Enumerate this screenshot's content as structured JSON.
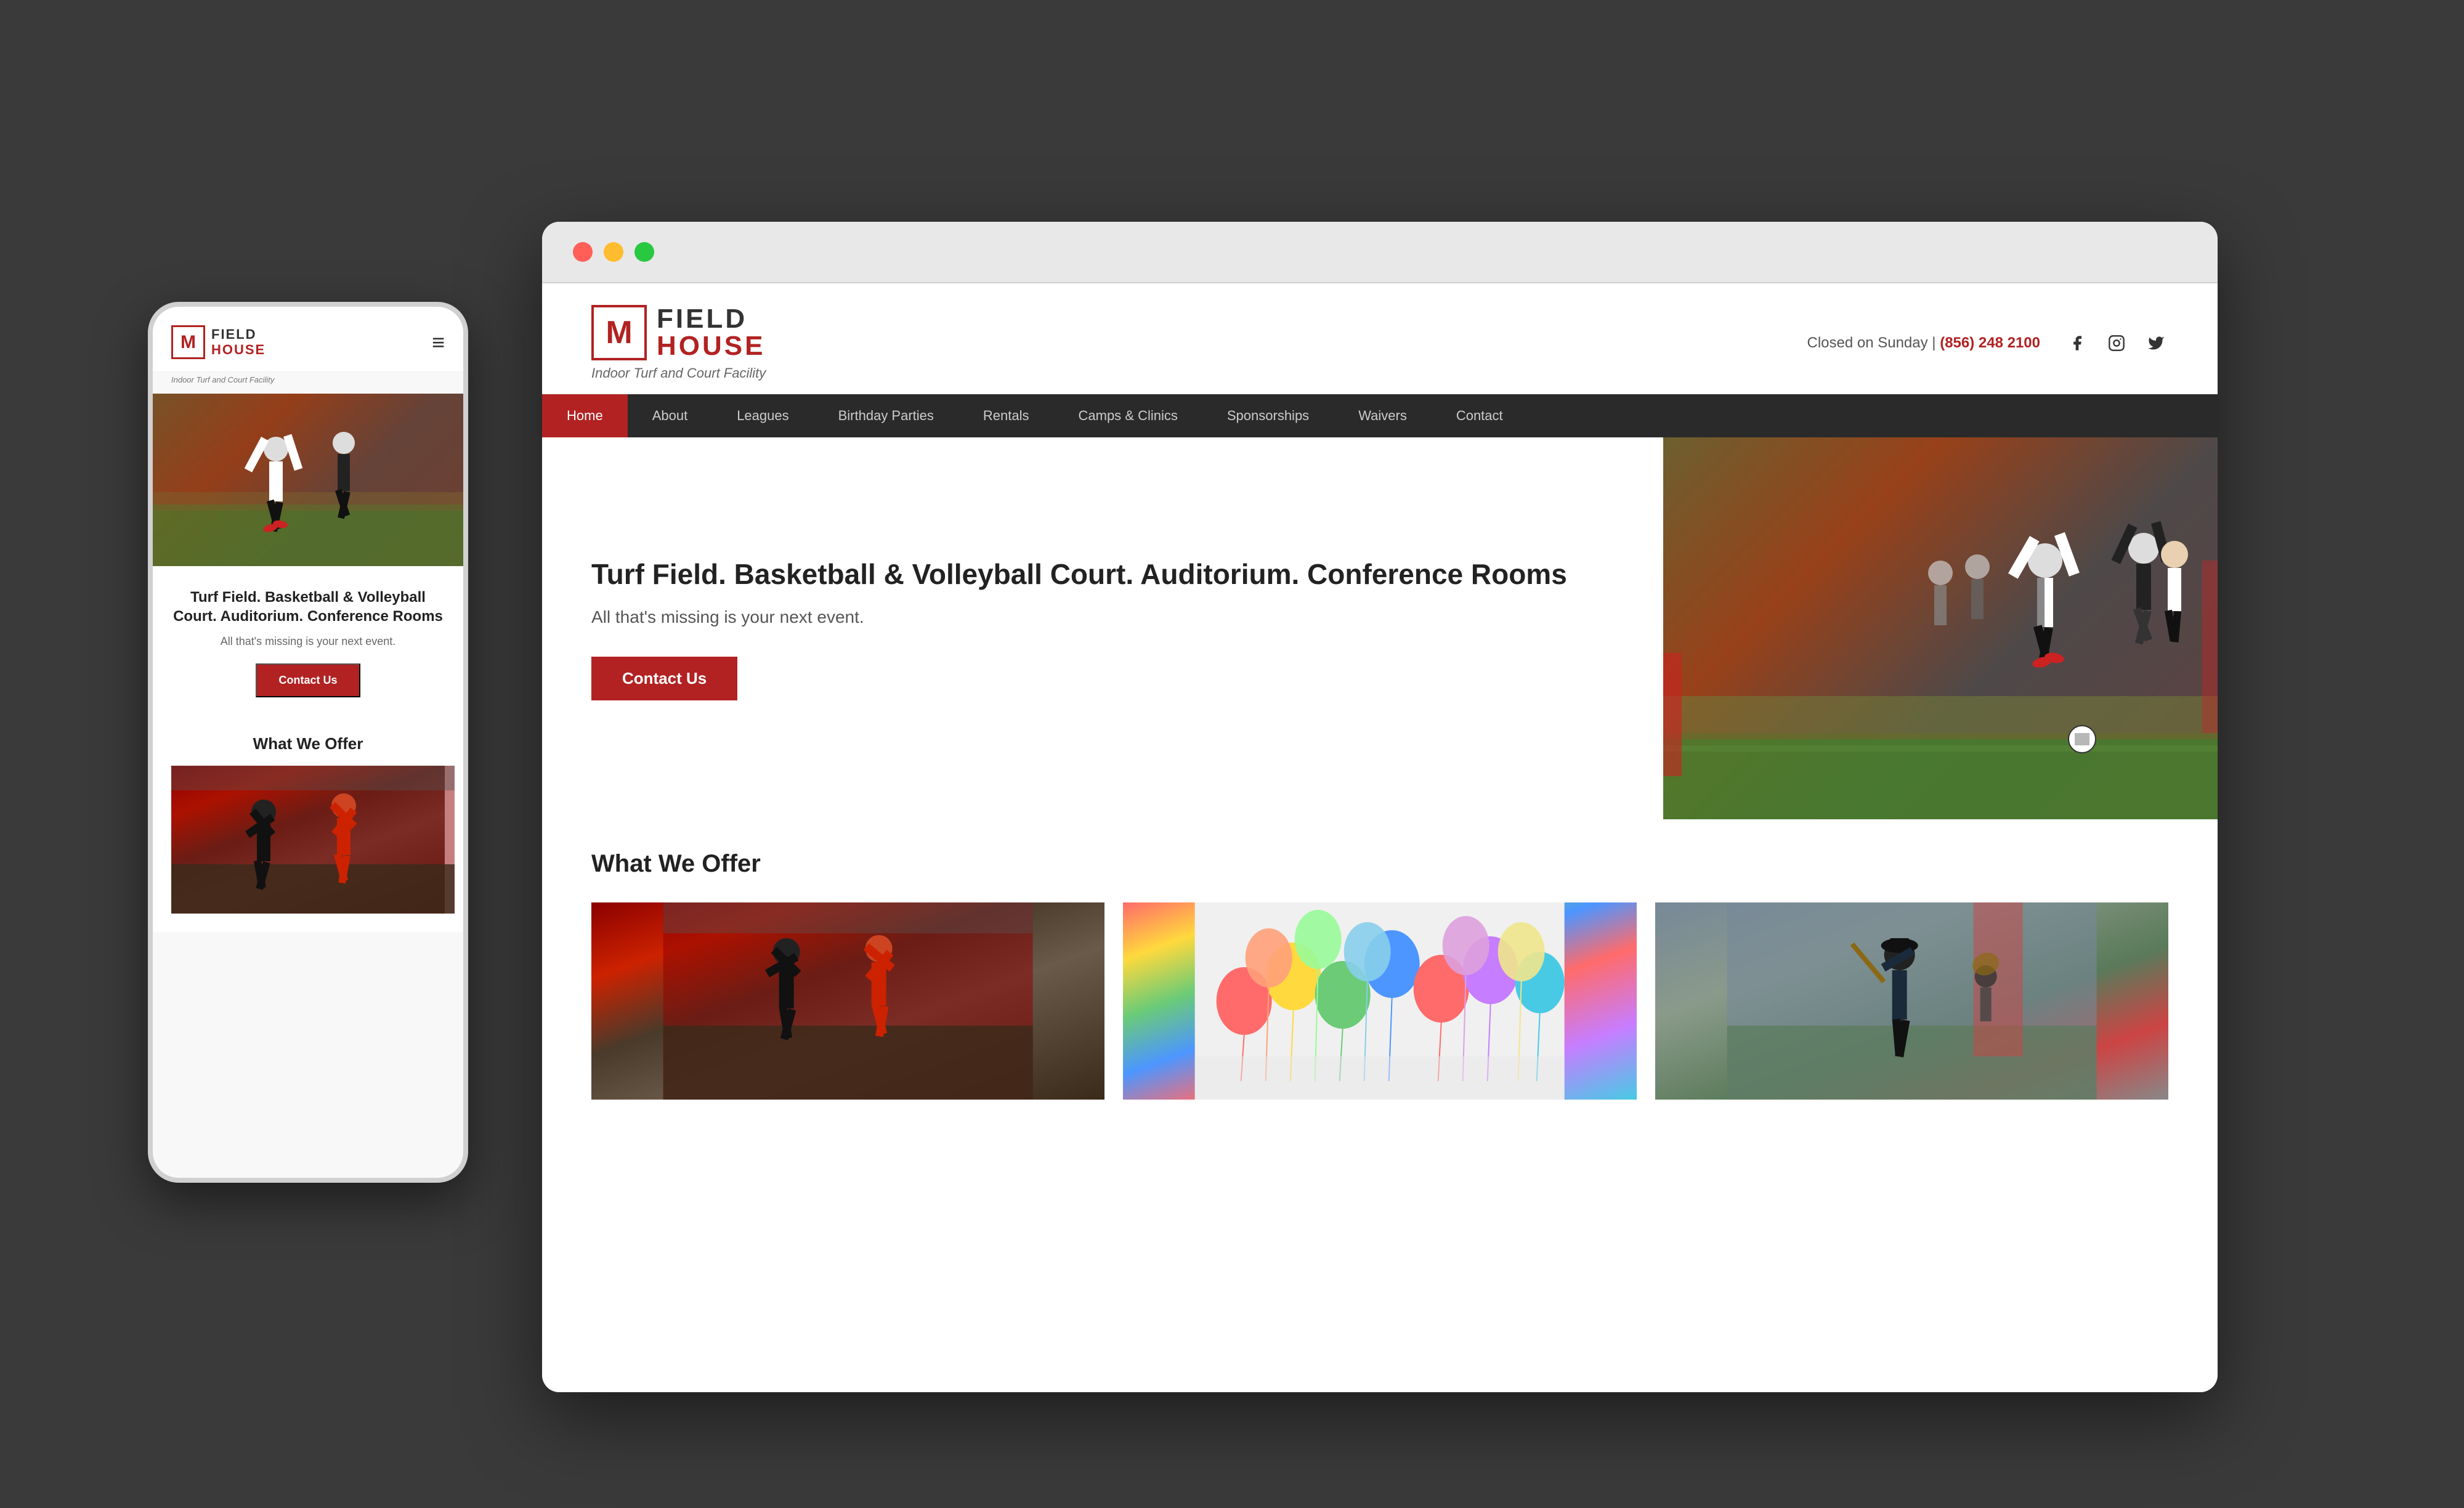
{
  "page": {
    "background": "#3a3a3a"
  },
  "browser": {
    "buttons": {
      "red": "close",
      "yellow": "minimize",
      "green": "maximize"
    }
  },
  "desktop": {
    "header": {
      "logo": {
        "field_text": "FIELD",
        "house_text": "HOUSE",
        "subtitle": "Indoor Turf and Court Facility",
        "m_letter": "M"
      },
      "contact_info": "Closed on Sunday",
      "pipe": "|",
      "phone": "(856) 248 2100",
      "social": {
        "facebook": "f",
        "instagram": "ig",
        "twitter": "tw"
      }
    },
    "nav": {
      "items": [
        {
          "label": "Home",
          "active": true
        },
        {
          "label": "About",
          "active": false
        },
        {
          "label": "Leagues",
          "active": false
        },
        {
          "label": "Birthday Parties",
          "active": false
        },
        {
          "label": "Rentals",
          "active": false
        },
        {
          "label": "Camps & Clinics",
          "active": false
        },
        {
          "label": "Sponsorships",
          "active": false
        },
        {
          "label": "Waivers",
          "active": false
        },
        {
          "label": "Contact",
          "active": false
        }
      ]
    },
    "hero": {
      "title": "Turf Field. Basketball & Volleyball Court. Auditorium. Conference Rooms",
      "subtitle": "All that's missing is your next event.",
      "button_label": "Contact Us"
    },
    "offers": {
      "section_title": "What We Offer",
      "cards": [
        {
          "id": "basketball",
          "alt": "Basketball court"
        },
        {
          "id": "balloons",
          "alt": "Birthday party balloons"
        },
        {
          "id": "baseball",
          "alt": "Baseball player"
        }
      ]
    }
  },
  "mobile": {
    "header": {
      "logo": {
        "field_text": "FIELD",
        "house_text": "HOUSE",
        "subtitle": "Indoor Turf and Court Facility",
        "m_letter": "M"
      },
      "menu_icon": "≡"
    },
    "hero": {
      "title": "Turf Field. Basketball & Volleyball Court. Auditorium. Conference Rooms",
      "subtitle": "All that's missing is your next event.",
      "button_label": "Contact Us"
    },
    "offers": {
      "section_title": "What We Offer"
    }
  }
}
